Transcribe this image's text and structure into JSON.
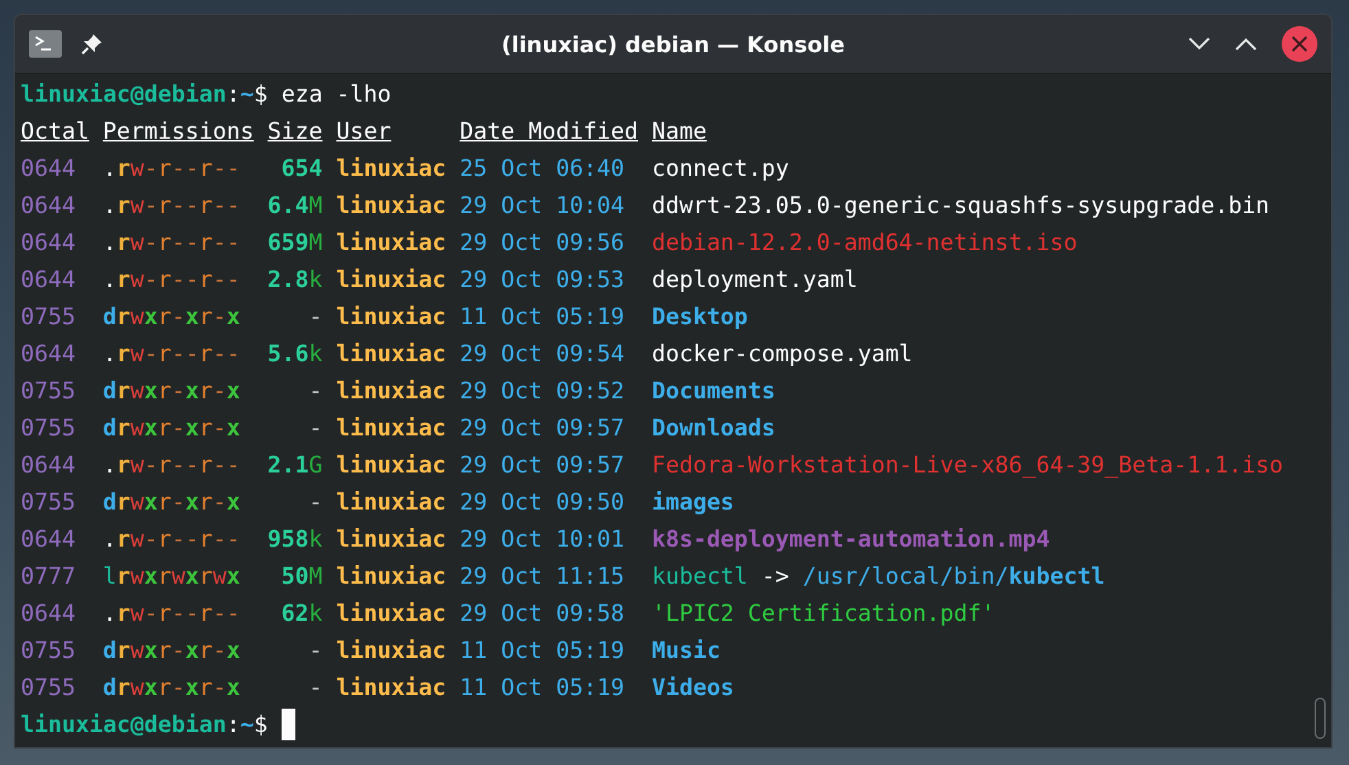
{
  "window": {
    "title": "(linuxiac) debian — Konsole"
  },
  "prompt": {
    "user_host": "linuxiac@debian",
    "separator": ":",
    "path": "~",
    "symbol": "$",
    "command": "eza -lho"
  },
  "headers": [
    "Octal",
    "Permissions",
    "Size",
    "User",
    "Date Modified",
    "Name"
  ],
  "rows": [
    {
      "octal": "0644",
      "permissions": ".rw-r--r--",
      "size": "654",
      "user": "linuxiac",
      "date": "25 Oct 06:40",
      "name": "connect.py",
      "kind": "file"
    },
    {
      "octal": "0644",
      "permissions": ".rw-r--r--",
      "size": "6.4M",
      "user": "linuxiac",
      "date": "29 Oct 10:04",
      "name": "ddwrt-23.05.0-generic-squashfs-sysupgrade.bin",
      "kind": "file"
    },
    {
      "octal": "0644",
      "permissions": ".rw-r--r--",
      "size": "659M",
      "user": "linuxiac",
      "date": "29 Oct 09:56",
      "name": "debian-12.2.0-amd64-netinst.iso",
      "kind": "archive"
    },
    {
      "octal": "0644",
      "permissions": ".rw-r--r--",
      "size": "2.8k",
      "user": "linuxiac",
      "date": "29 Oct 09:53",
      "name": "deployment.yaml",
      "kind": "file"
    },
    {
      "octal": "0755",
      "permissions": "drwxr-xr-x",
      "size": "-",
      "user": "linuxiac",
      "date": "11 Oct 05:19",
      "name": "Desktop",
      "kind": "directory"
    },
    {
      "octal": "0644",
      "permissions": ".rw-r--r--",
      "size": "5.6k",
      "user": "linuxiac",
      "date": "29 Oct 09:54",
      "name": "docker-compose.yaml",
      "kind": "file"
    },
    {
      "octal": "0755",
      "permissions": "drwxr-xr-x",
      "size": "-",
      "user": "linuxiac",
      "date": "29 Oct 09:52",
      "name": "Documents",
      "kind": "directory"
    },
    {
      "octal": "0755",
      "permissions": "drwxr-xr-x",
      "size": "-",
      "user": "linuxiac",
      "date": "29 Oct 09:57",
      "name": "Downloads",
      "kind": "directory"
    },
    {
      "octal": "0644",
      "permissions": ".rw-r--r--",
      "size": "2.1G",
      "user": "linuxiac",
      "date": "29 Oct 09:57",
      "name": "Fedora-Workstation-Live-x86_64-39_Beta-1.1.iso",
      "kind": "archive"
    },
    {
      "octal": "0755",
      "permissions": "drwxr-xr-x",
      "size": "-",
      "user": "linuxiac",
      "date": "29 Oct 09:50",
      "name": "images",
      "kind": "directory"
    },
    {
      "octal": "0644",
      "permissions": ".rw-r--r--",
      "size": "958k",
      "user": "linuxiac",
      "date": "29 Oct 10:01",
      "name": "k8s-deployment-automation.mp4",
      "kind": "video"
    },
    {
      "octal": "0777",
      "permissions": "lrwxrwxrwx",
      "size": "50M",
      "user": "linuxiac",
      "date": "29 Oct 11:15",
      "name": "kubectl",
      "kind": "symlink",
      "arrow": "->",
      "target_dir": "/usr/local/bin/",
      "target_file": "kubectl"
    },
    {
      "octal": "0644",
      "permissions": ".rw-r--r--",
      "size": "62k",
      "user": "linuxiac",
      "date": "29 Oct 09:58",
      "name": "'LPIC2 Certification.pdf'",
      "kind": "document"
    },
    {
      "octal": "0755",
      "permissions": "drwxr-xr-x",
      "size": "-",
      "user": "linuxiac",
      "date": "11 Oct 05:19",
      "name": "Music",
      "kind": "directory"
    },
    {
      "octal": "0755",
      "permissions": "drwxr-xr-x",
      "size": "-",
      "user": "linuxiac",
      "date": "11 Oct 05:19",
      "name": "Videos",
      "kind": "directory"
    }
  ],
  "final_prompt": {
    "user_host": "linuxiac@debian",
    "separator": ":",
    "path": "~",
    "symbol": "$"
  }
}
